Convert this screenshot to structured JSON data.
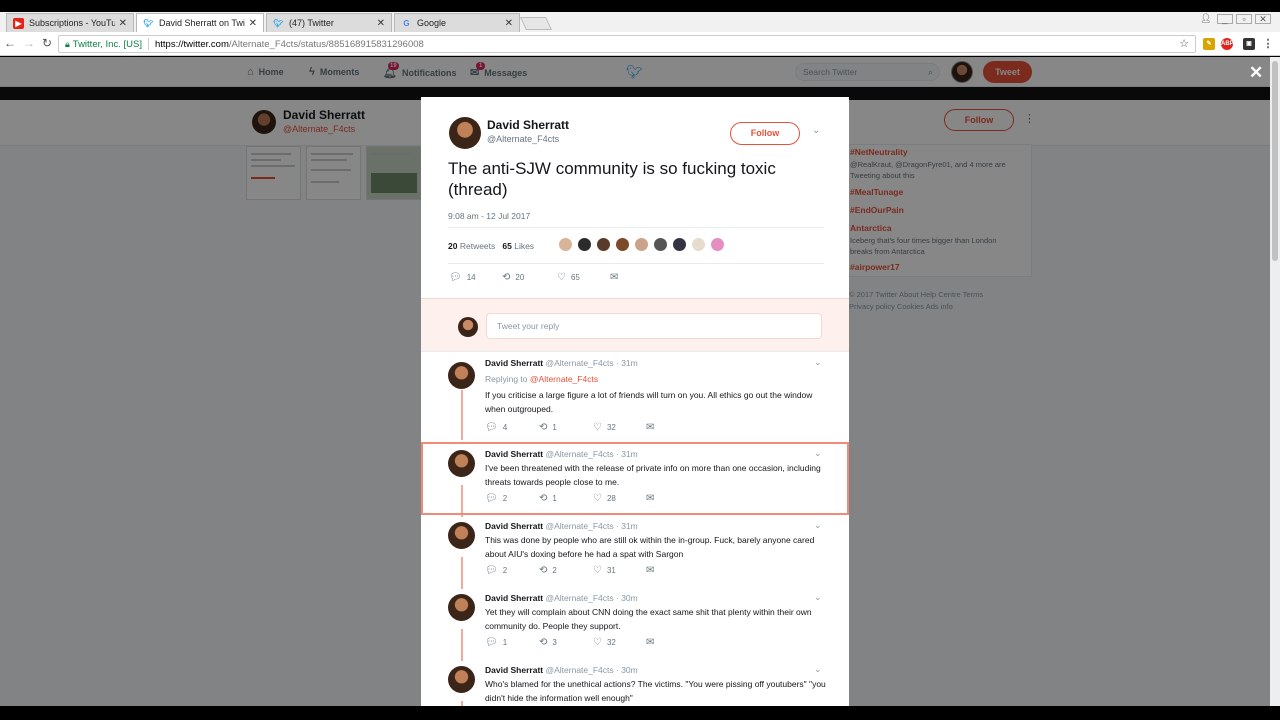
{
  "browser": {
    "tabs": [
      {
        "title": "Subscriptions - YouTube",
        "icon": "youtube-icon",
        "active": false
      },
      {
        "title": "David Sherratt on Twitte",
        "icon": "twitter-bird-icon",
        "active": true
      },
      {
        "title": "(47) Twitter",
        "icon": "twitter-bird-icon",
        "active": false
      },
      {
        "title": "Google",
        "icon": "google-icon",
        "active": false
      }
    ],
    "address": {
      "cert": "Twitter, Inc. [US]",
      "url_host": "https://twitter.com",
      "url_path": "/Alternate_F4cts/status/885168915831296008"
    }
  },
  "twitter_nav": {
    "home": "Home",
    "moments": "Moments",
    "notifications": "Notifications",
    "notifications_badge": "19",
    "messages": "Messages",
    "messages_badge": "1",
    "search_placeholder": "Search Twitter",
    "tweet_button": "Tweet"
  },
  "profile": {
    "name": "David Sherratt",
    "handle": "@Alternate_F4cts",
    "follow": "Follow"
  },
  "trends": [
    {
      "tag": "#NetNeutrality",
      "sub": [
        "@RealKraut, @DragonFyre01, and 4 more are",
        "Tweeting about this"
      ]
    },
    {
      "tag": "#MealTunage",
      "sub": []
    },
    {
      "tag": "#EndOurPain",
      "sub": []
    },
    {
      "tag": "Antarctica",
      "sub": [
        "Iceberg that's four times bigger than London",
        "breaks from Antarctica"
      ]
    },
    {
      "tag": "#airpower17",
      "sub": []
    }
  ],
  "footer": {
    "line1": "© 2017 Twitter   About   Help Centre   Terms",
    "line2": "Privacy policy   Cookies   Ads info"
  },
  "tweet": {
    "name": "David Sherratt",
    "handle": "@Alternate_F4cts",
    "follow": "Follow",
    "text": "The anti-SJW community is so fucking toxic (thread)",
    "time": "9:08 am - 12 Jul 2017",
    "retweets_count": "20",
    "retweets_label": "Retweets",
    "likes_count": "65",
    "likes_label": "Likes",
    "actions": {
      "replies": "14",
      "retweets": "20",
      "likes": "65"
    },
    "reply_placeholder": "Tweet your reply"
  },
  "replies": [
    {
      "name": "David Sherratt",
      "meta": "@Alternate_F4cts · 31m",
      "replying_prefix": "Replying to",
      "replying_to": "@Alternate_F4cts",
      "text": "If you criticise a large figure a lot of friends will turn on you. All ethics go out the window when outgrouped.",
      "replies": "4",
      "retweets": "1",
      "likes": "32"
    },
    {
      "name": "David Sherratt",
      "meta": "@Alternate_F4cts · 31m",
      "text": "I've been threatened with the release of private info on more than one occasion, including threats towards people close to me.",
      "replies": "2",
      "retweets": "1",
      "likes": "28"
    },
    {
      "name": "David Sherratt",
      "meta": "@Alternate_F4cts · 31m",
      "text": "This was done by people who are still ok within the in-group. Fuck, barely anyone cared about AIU's doxing before he had a spat with Sargon",
      "replies": "2",
      "retweets": "2",
      "likes": "31"
    },
    {
      "name": "David Sherratt",
      "meta": "@Alternate_F4cts · 30m",
      "text": "Yet they will complain about CNN doing the exact same shit that plenty within their own community do. People they support.",
      "replies": "1",
      "retweets": "3",
      "likes": "32"
    },
    {
      "name": "David Sherratt",
      "meta": "@Alternate_F4cts · 30m",
      "text": "Who's blamed for the unethical actions? The victims. \"You were pissing off youtubers\" \"you didn't hide the information well enough\""
    }
  ],
  "colors": {
    "accent": "#e8513a",
    "twitter_blue": "#1da1f2",
    "text": "#14171a",
    "muted": "#66757f"
  }
}
